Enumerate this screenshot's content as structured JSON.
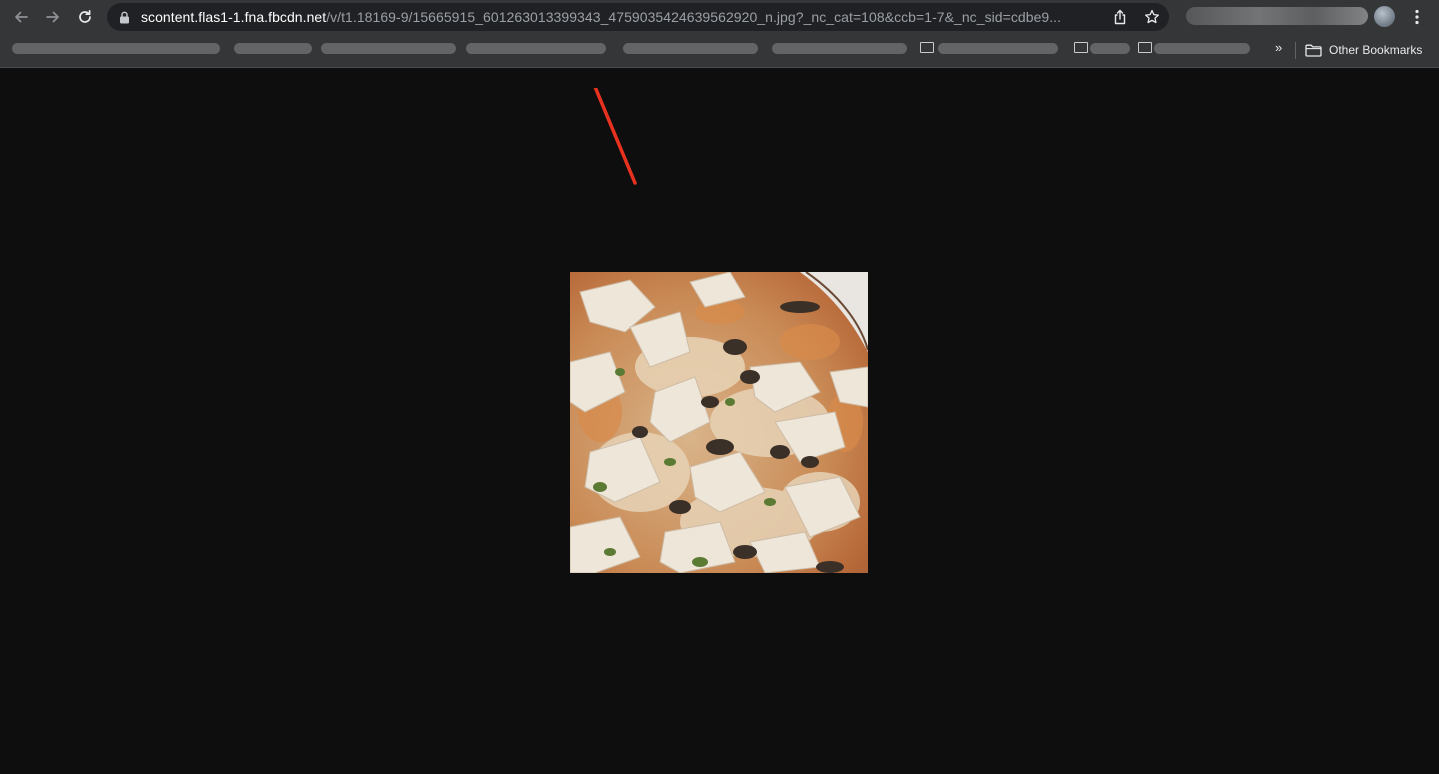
{
  "browser": {
    "url_host": "scontent.flas1-1.fna.fbcdn.net",
    "url_path": "/v/t1.18169-9/15665915_601263013399343_4759035424639562920_n.jpg?_nc_cat=108&ccb=1-7&_nc_sid=cdbe9...",
    "icons": {
      "back": "arrow-left-icon",
      "forward": "arrow-right-icon",
      "reload": "reload-icon",
      "lock": "lock-icon",
      "share": "share-icon",
      "bookmark": "star-icon",
      "menu": "kebab-menu-icon",
      "folder": "folder-icon",
      "overflow": "chevrons-right-icon"
    }
  },
  "bookmarks": {
    "overflow_label": "»",
    "other_label": "Other Bookmarks"
  },
  "viewport": {
    "image_alt": "pizza-photo",
    "annotation_color": "#e8321f",
    "background": "#0e0e0e"
  }
}
